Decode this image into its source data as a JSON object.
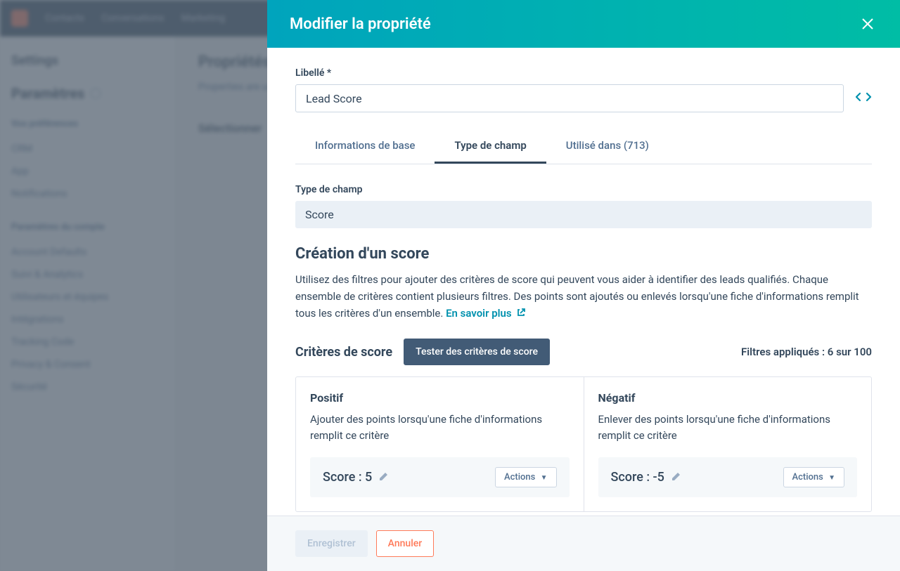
{
  "bg": {
    "nav": [
      "Contacts",
      "Conversations",
      "Marketing"
    ],
    "sideTitle": "Settings",
    "sideHeading": "Paramètres",
    "section1": "Vos préférences",
    "links1": [
      "CRM",
      "App",
      "Notifications"
    ],
    "section2": "Paramètres du compte",
    "links2": [
      "Account Defaults",
      "Suivi & Analytics",
      "Utilisateurs et équipes",
      "Intégrations",
      "Tracking Code",
      "Privacy & Consent",
      "Sécurité"
    ],
    "mainTitle": "Propriétés",
    "mainDesc": "Properties are used to collect and store information about your contacts.",
    "subhead": "Sélectionner"
  },
  "modal": {
    "title": "Modifier la propriété",
    "labelField": "Libellé *",
    "labelValue": "Lead Score",
    "tabs": {
      "basic": "Informations de base",
      "fieldType": "Type de champ",
      "usedIn": "Utilisé dans (713)"
    },
    "fieldTypeLabel": "Type de champ",
    "fieldTypeValue": "Score",
    "scoreHeading": "Création d'un score",
    "scoreDesc": "Utilisez des filtres pour ajouter des critères de score qui peuvent vous aider à identifier des leads qualifiés. Chaque ensemble de critères contient plusieurs filtres. Des points sont ajoutés ou enlevés lorsqu'une fiche d'informations remplit tous les critères d'un ensemble. ",
    "learnMore": "En savoir plus",
    "criteriaTitle": "Critères de score",
    "testBtn": "Tester des critères de score",
    "filtersApplied": "Filtres appliqués : 6 sur 100",
    "positive": {
      "title": "Positif",
      "desc": "Ajouter des points lorsqu'une fiche d'informations remplit ce critère",
      "scoreLabel": "Score : 5"
    },
    "negative": {
      "title": "Négatif",
      "desc": "Enlever des points lorsqu'une fiche d'informations remplit ce critère",
      "scoreLabel": "Score : -5"
    },
    "actionsLabel": "Actions",
    "saveBtn": "Enregistrer",
    "cancelBtn": "Annuler"
  }
}
